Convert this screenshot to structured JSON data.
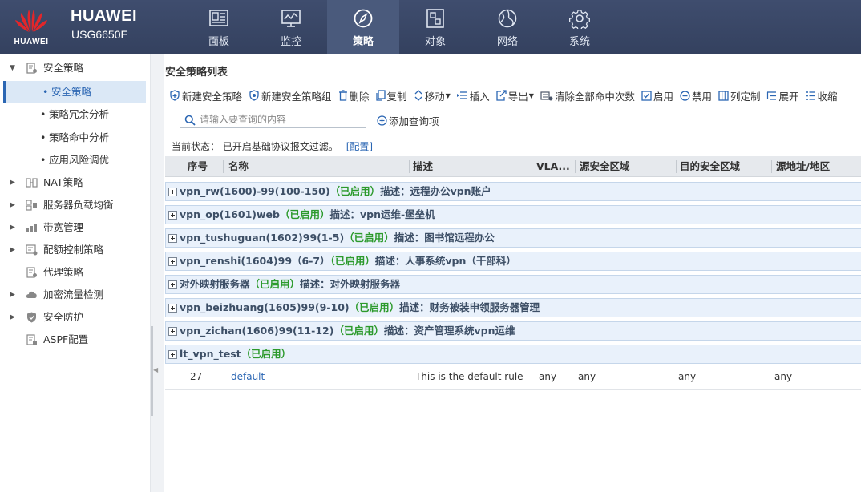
{
  "brand": {
    "logo_text": "HUAWEI",
    "name": "HUAWEI",
    "model": "USG6650E"
  },
  "nav": [
    {
      "label": "面板",
      "icon": "dashboard-icon"
    },
    {
      "label": "监控",
      "icon": "monitor-icon"
    },
    {
      "label": "策略",
      "icon": "compass-icon",
      "active": true
    },
    {
      "label": "对象",
      "icon": "object-icon"
    },
    {
      "label": "网络",
      "icon": "globe-icon"
    },
    {
      "label": "系统",
      "icon": "gear-icon"
    }
  ],
  "sidebar": {
    "items": [
      {
        "label": "安全策略",
        "icon": "policy-icon",
        "expanded": true
      },
      {
        "label": "NAT策略",
        "icon": "nat-icon"
      },
      {
        "label": "服务器负载均衡",
        "icon": "server-lb-icon"
      },
      {
        "label": "带宽管理",
        "icon": "bandwidth-icon"
      },
      {
        "label": "配额控制策略",
        "icon": "quota-icon"
      },
      {
        "label": "代理策略",
        "icon": "proxy-icon"
      },
      {
        "label": "加密流量检测",
        "icon": "encrypted-traffic-icon"
      },
      {
        "label": "安全防护",
        "icon": "shield-icon"
      },
      {
        "label": "ASPF配置",
        "icon": "aspf-icon"
      }
    ],
    "sub_items": [
      {
        "label": "安全策略",
        "active": true
      },
      {
        "label": "策略冗余分析"
      },
      {
        "label": "策略命中分析"
      },
      {
        "label": "应用风险调优"
      }
    ]
  },
  "main": {
    "title": "安全策略列表",
    "toolbar": {
      "new_policy": "新建安全策略",
      "new_group": "新建安全策略组",
      "delete": "删除",
      "copy": "复制",
      "move": "移动",
      "insert": "插入",
      "export": "导出",
      "clear_hits": "清除全部命中次数",
      "enable": "启用",
      "disable": "禁用",
      "customize_columns": "列定制",
      "expand": "展开",
      "collapse": "收缩"
    },
    "search": {
      "placeholder": "请输入要查询的内容",
      "value": ""
    },
    "add_query": "添加查询项",
    "status": {
      "label": "当前状态：",
      "text": "已开启基础协议报文过滤。",
      "link": "[配置]"
    },
    "table": {
      "columns": [
        "序号",
        "名称",
        "描述",
        "VLA...",
        "源安全区域",
        "目的安全区域",
        "源地址/地区"
      ],
      "groups": [
        {
          "name": "vpn_rw(1600)-99(100-150)",
          "enabled": "（已启用）",
          "desc": "描述：远程办公vpn账户"
        },
        {
          "name": "vpn_op(1601)web",
          "enabled": "（已启用）",
          "desc": "描述：vpn运维-堡垒机"
        },
        {
          "name": "vpn_tushuguan(1602)99(1-5)",
          "enabled": "（已启用）",
          "desc": "描述：图书馆远程办公"
        },
        {
          "name": "vpn_renshi(1604)99（6-7）",
          "enabled": "（已启用）",
          "desc": "描述：人事系统vpn（干部科）"
        },
        {
          "name": "对外映射服务器",
          "enabled": "（已启用）",
          "desc": "描述：对外映射服务器"
        },
        {
          "name": "vpn_beizhuang(1605)99(9-10)",
          "enabled": "（已启用）",
          "desc": "描述：财务被装申领服务器管理"
        },
        {
          "name": "vpn_zichan(1606)99(11-12)",
          "enabled": "（已启用）",
          "desc": "描述：资产管理系统vpn运维"
        },
        {
          "name": "lt_vpn_test",
          "enabled": "（已启用）",
          "desc": ""
        }
      ],
      "rows": [
        {
          "seq": "27",
          "name": "default",
          "desc": "This is the default rule",
          "vlan": "any",
          "src_zone": "any",
          "dst_zone": "any",
          "src_addr": "any"
        }
      ]
    }
  },
  "colors": {
    "topbar": "#3a4766",
    "accent": "#2b66b3",
    "enabled": "#2c9a2c",
    "group_bg": "#e9f1fb"
  }
}
